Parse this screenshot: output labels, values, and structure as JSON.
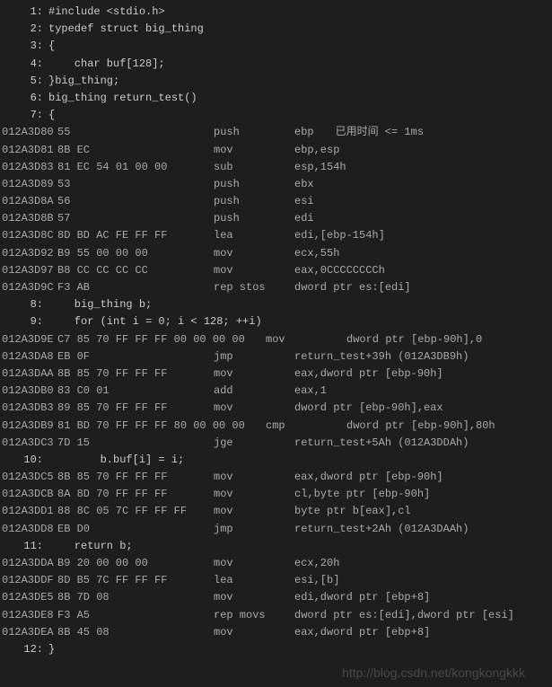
{
  "source": {
    "l1": {
      "num": "1:",
      "code": "#include <stdio.h>"
    },
    "l2": {
      "num": "2:",
      "code": "typedef struct big_thing"
    },
    "l3": {
      "num": "3:",
      "code": "{"
    },
    "l4": {
      "num": "4:",
      "code": "    char buf[128];"
    },
    "l5": {
      "num": "5:",
      "code": "}big_thing;"
    },
    "l6": {
      "num": "6:",
      "code": "big_thing return_test()"
    },
    "l7": {
      "num": "7:",
      "code": "{"
    },
    "l8": {
      "num": "8:",
      "code": "    big_thing b;"
    },
    "l9": {
      "num": "9:",
      "code": "    for (int i = 0; i < 128; ++i)"
    },
    "l10": {
      "num": "10:",
      "code": "        b.buf[i] = i;"
    },
    "l11": {
      "num": "11:",
      "code": "    return b;"
    },
    "l12": {
      "num": "12:",
      "code": "}"
    }
  },
  "timing": "已用时间 <= 1ms",
  "asm": {
    "a1": {
      "addr": "012A3D80",
      "bytes": "55",
      "mn": "push",
      "op": "ebp"
    },
    "a2": {
      "addr": "012A3D81",
      "bytes": "8B EC",
      "mn": "mov",
      "op": "ebp,esp"
    },
    "a3": {
      "addr": "012A3D83",
      "bytes": "81 EC 54 01 00 00",
      "mn": "sub",
      "op": "esp,154h"
    },
    "a4": {
      "addr": "012A3D89",
      "bytes": "53",
      "mn": "push",
      "op": "ebx"
    },
    "a5": {
      "addr": "012A3D8A",
      "bytes": "56",
      "mn": "push",
      "op": "esi"
    },
    "a6": {
      "addr": "012A3D8B",
      "bytes": "57",
      "mn": "push",
      "op": "edi"
    },
    "a7": {
      "addr": "012A3D8C",
      "bytes": "8D BD AC FE FF FF",
      "mn": "lea",
      "op": "edi,[ebp-154h]"
    },
    "a8": {
      "addr": "012A3D92",
      "bytes": "B9 55 00 00 00",
      "mn": "mov",
      "op": "ecx,55h"
    },
    "a9": {
      "addr": "012A3D97",
      "bytes": "B8 CC CC CC CC",
      "mn": "mov",
      "op": "eax,0CCCCCCCCh"
    },
    "a10": {
      "addr": "012A3D9C",
      "bytes": "F3 AB",
      "mn": "rep stos",
      "op": "dword ptr es:[edi]"
    },
    "a11": {
      "addr": "012A3D9E",
      "bytes": "C7 85 70 FF FF FF 00 00 00 00",
      "mn": "mov",
      "op": "dword ptr [ebp-90h],0"
    },
    "a12": {
      "addr": "012A3DA8",
      "bytes": "EB 0F",
      "mn": "jmp",
      "op": "return_test+39h (012A3DB9h)"
    },
    "a13": {
      "addr": "012A3DAA",
      "bytes": "8B 85 70 FF FF FF",
      "mn": "mov",
      "op": "eax,dword ptr [ebp-90h]"
    },
    "a14": {
      "addr": "012A3DB0",
      "bytes": "83 C0 01",
      "mn": "add",
      "op": "eax,1"
    },
    "a15": {
      "addr": "012A3DB3",
      "bytes": "89 85 70 FF FF FF",
      "mn": "mov",
      "op": "dword ptr [ebp-90h],eax"
    },
    "a16": {
      "addr": "012A3DB9",
      "bytes": "81 BD 70 FF FF FF 80 00 00 00",
      "mn": "cmp",
      "op": "dword ptr [ebp-90h],80h"
    },
    "a17": {
      "addr": "012A3DC3",
      "bytes": "7D 15",
      "mn": "jge",
      "op": "return_test+5Ah (012A3DDAh)"
    },
    "a18": {
      "addr": "012A3DC5",
      "bytes": "8B 85 70 FF FF FF",
      "mn": "mov",
      "op": "eax,dword ptr [ebp-90h]"
    },
    "a19": {
      "addr": "012A3DCB",
      "bytes": "8A 8D 70 FF FF FF",
      "mn": "mov",
      "op": "cl,byte ptr [ebp-90h]"
    },
    "a20": {
      "addr": "012A3DD1",
      "bytes": "88 8C 05 7C FF FF FF",
      "mn": "mov",
      "op": "byte ptr b[eax],cl"
    },
    "a21": {
      "addr": "012A3DD8",
      "bytes": "EB D0",
      "mn": "jmp",
      "op": "return_test+2Ah (012A3DAAh)"
    },
    "a22": {
      "addr": "012A3DDA",
      "bytes": "B9 20 00 00 00",
      "mn": "mov",
      "op": "ecx,20h"
    },
    "a23": {
      "addr": "012A3DDF",
      "bytes": "8D B5 7C FF FF FF",
      "mn": "lea",
      "op": "esi,[b]"
    },
    "a24": {
      "addr": "012A3DE5",
      "bytes": "8B 7D 08",
      "mn": "mov",
      "op": "edi,dword ptr [ebp+8]"
    },
    "a25": {
      "addr": "012A3DE8",
      "bytes": "F3 A5",
      "mn": "rep movs",
      "op": "dword ptr es:[edi],dword ptr [esi]"
    },
    "a26": {
      "addr": "012A3DEA",
      "bytes": "8B 45 08",
      "mn": "mov",
      "op": "eax,dword ptr [ebp+8]"
    }
  },
  "watermark": "http://blog.csdn.net/kongkongkkk"
}
